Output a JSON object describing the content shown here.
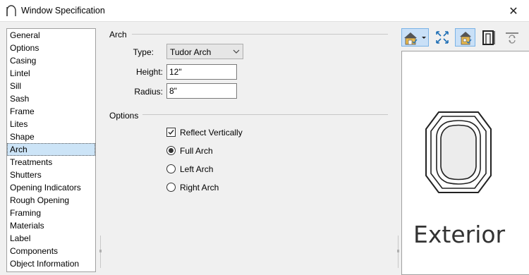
{
  "window": {
    "title": "Window Specification",
    "close_glyph": "✕"
  },
  "sidebar": {
    "items": [
      {
        "label": "General"
      },
      {
        "label": "Options"
      },
      {
        "label": "Casing"
      },
      {
        "label": "Lintel"
      },
      {
        "label": "Sill"
      },
      {
        "label": "Sash"
      },
      {
        "label": "Frame"
      },
      {
        "label": "Lites"
      },
      {
        "label": "Shape"
      },
      {
        "label": "Arch",
        "selected": true
      },
      {
        "label": "Treatments"
      },
      {
        "label": "Shutters"
      },
      {
        "label": "Opening Indicators"
      },
      {
        "label": "Rough Opening"
      },
      {
        "label": "Framing"
      },
      {
        "label": "Materials"
      },
      {
        "label": "Label"
      },
      {
        "label": "Components"
      },
      {
        "label": "Object Information"
      }
    ]
  },
  "arch": {
    "group_label": "Arch",
    "type_label": "Type:",
    "type_value": "Tudor Arch",
    "height_label": "Height:",
    "height_value": "12\"",
    "radius_label": "Radius:",
    "radius_value": "8\""
  },
  "options": {
    "group_label": "Options",
    "reflect_vertically": {
      "label": "Reflect Vertically",
      "checked": true
    },
    "radios": [
      {
        "label": "Full Arch",
        "selected": true
      },
      {
        "label": "Left Arch",
        "selected": false
      },
      {
        "label": "Right Arch",
        "selected": false
      }
    ]
  },
  "preview": {
    "view_label": "Exterior",
    "toolbar_icons": [
      "camera-view-icon",
      "fit-to-window-icon",
      "color-house-icon",
      "door-frame-icon",
      "refresh-icon"
    ]
  },
  "colors": {
    "selection": "#cce4f7",
    "toolbar_active": "#c9e0f7",
    "icon_blue": "#1f6fb5"
  }
}
